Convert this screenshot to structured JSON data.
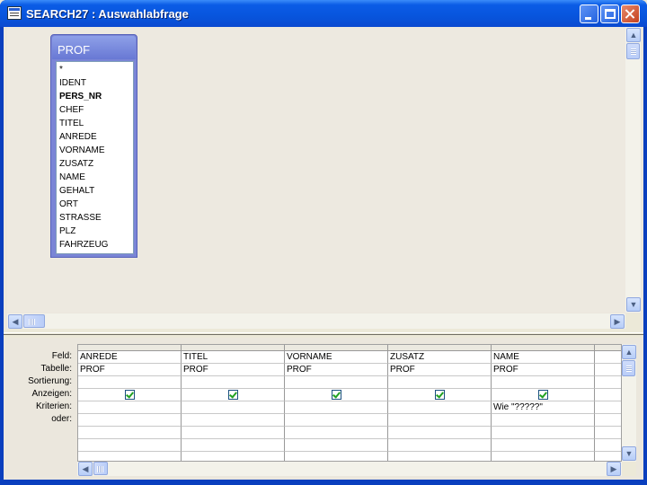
{
  "window": {
    "title": "SEARCH27 : Auswahlabfrage"
  },
  "table": {
    "name": "PROF",
    "fields": [
      "*",
      "IDENT",
      "PERS_NR",
      "CHEF",
      "TITEL",
      "ANREDE",
      "VORNAME",
      "ZUSATZ",
      "NAME",
      "GEHALT",
      "ORT",
      "STRASSE",
      "PLZ",
      "FAHRZEUG"
    ],
    "key_field": "PERS_NR"
  },
  "grid": {
    "row_labels": {
      "feld": "Feld:",
      "tabelle": "Tabelle:",
      "sortierung": "Sortierung:",
      "anzeigen": "Anzeigen:",
      "kriterien": "Kriterien:",
      "oder": "oder:"
    },
    "columns": [
      {
        "feld": "ANREDE",
        "tabelle": "PROF",
        "sortierung": "",
        "anzeigen": true,
        "kriterien": "",
        "oder": ""
      },
      {
        "feld": "TITEL",
        "tabelle": "PROF",
        "sortierung": "",
        "anzeigen": true,
        "kriterien": "",
        "oder": ""
      },
      {
        "feld": "VORNAME",
        "tabelle": "PROF",
        "sortierung": "",
        "anzeigen": true,
        "kriterien": "",
        "oder": ""
      },
      {
        "feld": "ZUSATZ",
        "tabelle": "PROF",
        "sortierung": "",
        "anzeigen": true,
        "kriterien": "",
        "oder": ""
      },
      {
        "feld": "NAME",
        "tabelle": "PROF",
        "sortierung": "",
        "anzeigen": true,
        "kriterien": "Wie \"?????\"",
        "oder": ""
      }
    ]
  },
  "icons": {
    "app": "query-window-icon",
    "minimize": "minimize-icon",
    "maximize": "maximize-icon",
    "close": "close-icon",
    "scroll_up": "arrow-up-icon",
    "scroll_down": "arrow-down-icon",
    "scroll_left": "arrow-left-icon",
    "scroll_right": "arrow-right-icon",
    "checkbox": "checkmark-icon"
  },
  "colors": {
    "titlebar": "#0855dd",
    "table_header": "#7a85d6",
    "workspace": "#ede9e0",
    "check": "#21a121"
  }
}
